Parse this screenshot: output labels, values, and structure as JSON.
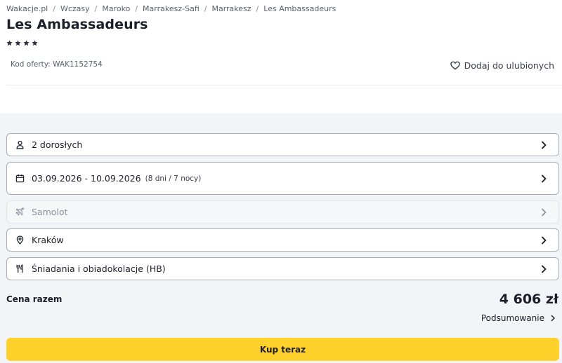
{
  "breadcrumb": {
    "items": [
      "Wakacje.pl",
      "Wczasy",
      "Maroko",
      "Marrakesz-Safi",
      "Marrakesz"
    ],
    "current": "Les Ambassadeurs",
    "separator": "/"
  },
  "hotel": {
    "name": "Les Ambassadeurs",
    "stars": 4
  },
  "offer": {
    "code": "Kod oferty: WAK1152754"
  },
  "favorite": {
    "label": "Dodaj do ulubionych"
  },
  "options": {
    "travelers": {
      "label": "2 dorosłych",
      "icon": "person-icon"
    },
    "dates": {
      "label": "03.09.2026 - 10.09.2026",
      "duration": "(8 dni / 7 nocy)",
      "icon": "calendar-icon"
    },
    "transport": {
      "label": "Samolot",
      "icon": "plane-icon",
      "enabled": false
    },
    "departure": {
      "label": "Kraków",
      "icon": "location-pin-icon"
    },
    "board": {
      "label": "Śniadania i obiadokolacje (HB)",
      "icon": "cutlery-icon"
    }
  },
  "price": {
    "label": "Cena razem",
    "value": "4 606 zł"
  },
  "summary": {
    "label": "Podsumowanie"
  },
  "cta": {
    "label": "Kup teraz"
  },
  "colors": {
    "accent": "#ffd12a",
    "text": "#1c1f2a",
    "panel": "#f3f4f7",
    "border": "#a9adb7"
  }
}
